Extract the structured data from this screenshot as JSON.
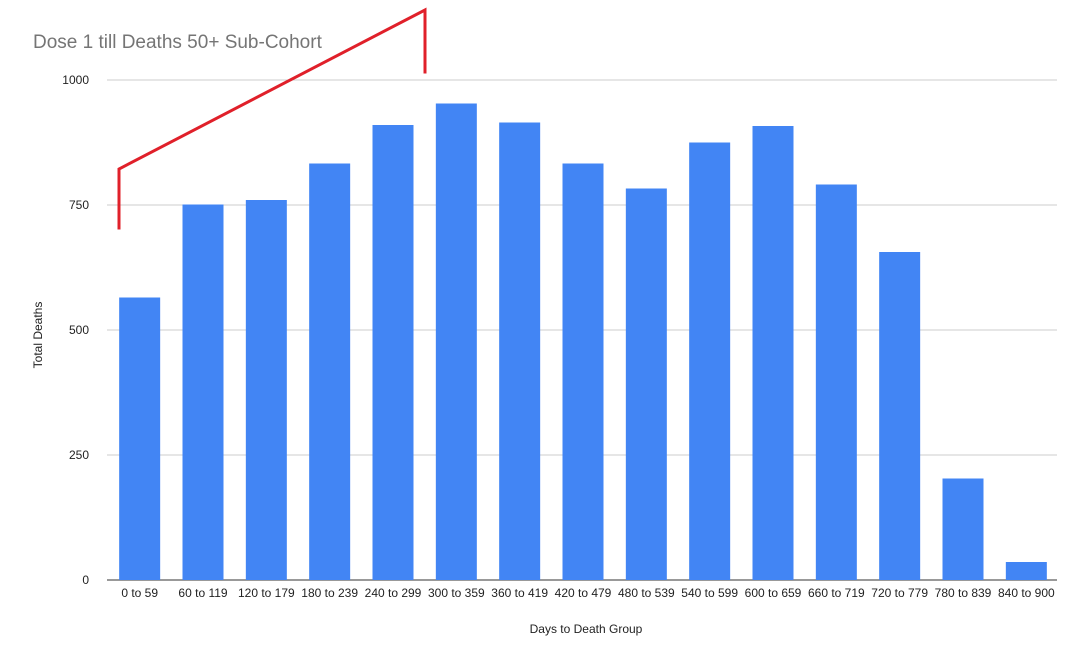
{
  "chart_data": {
    "type": "bar",
    "title": "Dose 1 till Deaths 50+ Sub-Cohort",
    "xlabel": "Days to Death Group",
    "ylabel": "Total Deaths",
    "categories": [
      "0 to 59",
      "60 to 119",
      "120 to 179",
      "180 to 239",
      "240 to 299",
      "300 to 359",
      "360 to 419",
      "420 to 479",
      "480 to 539",
      "540 to 599",
      "600 to 659",
      "660 to 719",
      "720 to 779",
      "780 to 839",
      "840 to 900"
    ],
    "series": [
      {
        "values": [
          565,
          751,
          760,
          833,
          910,
          953,
          915,
          833,
          783,
          875,
          908,
          791,
          656,
          203,
          36
        ]
      }
    ],
    "ylim": [
      0,
      1000
    ],
    "yticks": [
      "0",
      "250",
      "500",
      "750",
      "1000"
    ],
    "grid": true,
    "legend": "none",
    "bar_color": "#4285f4",
    "annotation_color": "#e0202a"
  }
}
